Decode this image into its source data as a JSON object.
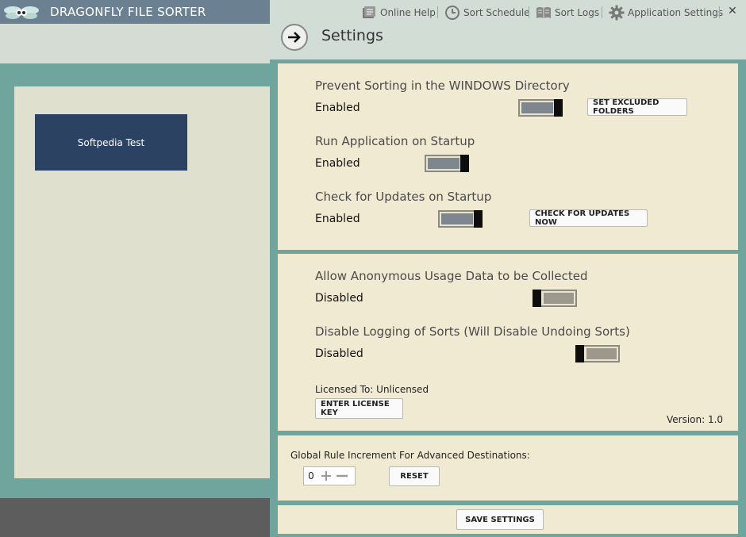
{
  "app": {
    "title": "DRAGONFLY FILE SORTER",
    "profile_name": "Softpedia Test"
  },
  "toolbar": {
    "online_help": "Online Help",
    "sort_schedule": "Sort Schedule",
    "sort_logs": "Sort Logs",
    "app_settings": "Application Settings",
    "close": "✕"
  },
  "page": {
    "title": "Settings"
  },
  "settings": [
    {
      "title": "Prevent Sorting in the WINDOWS Directory",
      "state": "Enabled",
      "on": true,
      "button": "SET EXCLUDED FOLDERS"
    },
    {
      "title": "Run Application on Startup",
      "state": "Enabled",
      "on": true
    },
    {
      "title": "Check for Updates on Startup",
      "state": "Enabled",
      "on": true,
      "button": "CHECK FOR UPDATES NOW"
    },
    {
      "title": "Allow Anonymous Usage Data to be Collected",
      "state": "Disabled",
      "on": false
    },
    {
      "title": "Disable Logging of Sorts (Will Disable Undoing Sorts)",
      "state": "Disabled",
      "on": false
    }
  ],
  "license": {
    "label": "Licensed To: Unlicensed",
    "button": "ENTER LICENSE KEY",
    "version": "Version: 1.0"
  },
  "increment": {
    "label": "Global Rule Increment For Advanced Destinations:",
    "value": "0",
    "reset": "RESET"
  },
  "footer": {
    "save": "SAVE SETTINGS"
  },
  "colors": {
    "titlebar": "#6b8191",
    "tile": "#2c4263",
    "panel": "#f1ead3",
    "accent_bg": "#6fa59c"
  }
}
